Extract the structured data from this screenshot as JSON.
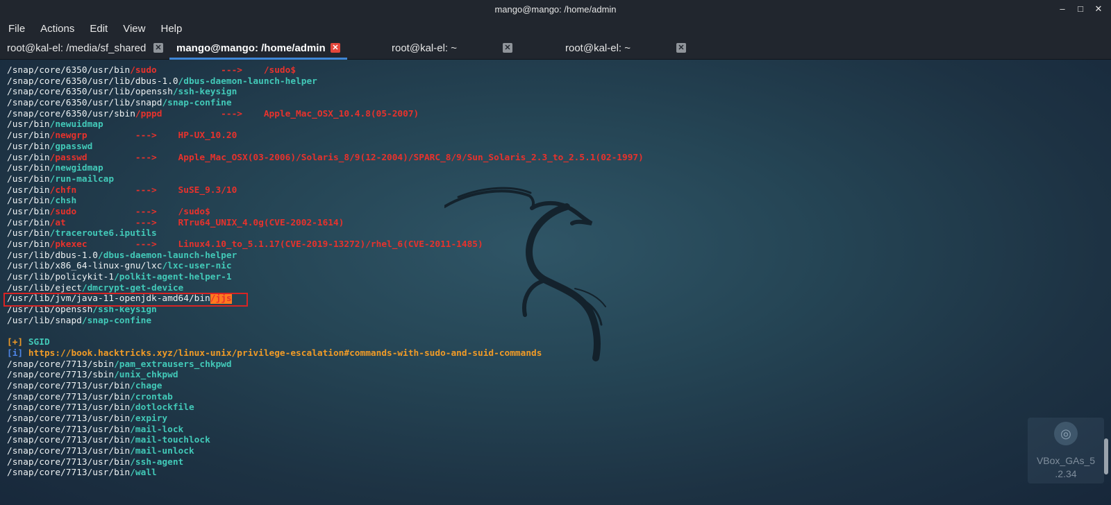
{
  "window": {
    "title": "mango@mango: /home/admin",
    "minimize_glyph": "–",
    "maximize_glyph": "□",
    "close_glyph": "✕"
  },
  "menu": [
    "File",
    "Actions",
    "Edit",
    "View",
    "Help"
  ],
  "tabs": [
    {
      "label": "root@kal-el: /media/sf_shared",
      "active": false,
      "close_icon": "✕"
    },
    {
      "label": "mango@mango: /home/admin",
      "active": true,
      "close_icon": "✕"
    },
    {
      "label": "root@kal-el: ~",
      "active": false,
      "close_icon": "✕"
    },
    {
      "label": "root@kal-el: ~",
      "active": false,
      "close_icon": "✕"
    }
  ],
  "colors": {
    "teal": "#42c9b8",
    "red": "#e8322c",
    "orange": "#f19b26",
    "blue": "#4f86e8",
    "highlight": "#ff7a1f",
    "active_tab_close": "#e4463b",
    "tab_underline": "#3f86d6"
  },
  "terminal": {
    "lines": [
      [
        {
          "t": "/snap/core/6350/usr/bin"
        },
        {
          "t": "/sudo",
          "c": "red"
        },
        {
          "t": "            --->    /sudo$",
          "c": "red"
        }
      ],
      [
        {
          "t": "/snap/core/6350/usr/lib/dbus-1.0"
        },
        {
          "t": "/dbus-daemon-launch-helper",
          "c": "teal"
        }
      ],
      [
        {
          "t": "/snap/core/6350/usr/lib/openssh"
        },
        {
          "t": "/ssh-keysign",
          "c": "teal"
        }
      ],
      [
        {
          "t": "/snap/core/6350/usr/lib/snapd"
        },
        {
          "t": "/snap-confine",
          "c": "teal"
        }
      ],
      [
        {
          "t": "/snap/core/6350/usr/sbin"
        },
        {
          "t": "/pppd",
          "c": "red"
        },
        {
          "t": "           --->    Apple_Mac_OSX_10.4.8(05-2007)",
          "c": "red"
        }
      ],
      [
        {
          "t": "/usr/bin"
        },
        {
          "t": "/newuidmap",
          "c": "teal"
        }
      ],
      [
        {
          "t": "/usr/bin"
        },
        {
          "t": "/newgrp",
          "c": "red"
        },
        {
          "t": "         --->    HP-UX_10.20",
          "c": "red"
        }
      ],
      [
        {
          "t": "/usr/bin"
        },
        {
          "t": "/gpasswd",
          "c": "teal"
        }
      ],
      [
        {
          "t": "/usr/bin"
        },
        {
          "t": "/passwd",
          "c": "red"
        },
        {
          "t": "         --->    Apple_Mac_OSX(03-2006)/Solaris_8/9(12-2004)/SPARC_8/9/Sun_Solaris_2.3_to_2.5.1(02-1997)",
          "c": "red"
        }
      ],
      [
        {
          "t": "/usr/bin"
        },
        {
          "t": "/newgidmap",
          "c": "teal"
        }
      ],
      [
        {
          "t": "/usr/bin"
        },
        {
          "t": "/run-mailcap",
          "c": "teal"
        }
      ],
      [
        {
          "t": "/usr/bin"
        },
        {
          "t": "/chfn",
          "c": "red"
        },
        {
          "t": "           --->    SuSE_9.3/10",
          "c": "red"
        }
      ],
      [
        {
          "t": "/usr/bin"
        },
        {
          "t": "/chsh",
          "c": "teal"
        }
      ],
      [
        {
          "t": "/usr/bin"
        },
        {
          "t": "/sudo",
          "c": "red"
        },
        {
          "t": "           --->    /sudo$",
          "c": "red"
        }
      ],
      [
        {
          "t": "/usr/bin"
        },
        {
          "t": "/at",
          "c": "red"
        },
        {
          "t": "             --->    RTru64_UNIX_4.0g(CVE-2002-1614)",
          "c": "red"
        }
      ],
      [
        {
          "t": "/usr/bin"
        },
        {
          "t": "/traceroute6.iputils",
          "c": "teal"
        }
      ],
      [
        {
          "t": "/usr/bin"
        },
        {
          "t": "/pkexec",
          "c": "red"
        },
        {
          "t": "         --->    Linux4.10_to_5.1.17(CVE-2019-13272)/rhel_6(CVE-2011-1485)",
          "c": "red"
        }
      ],
      [
        {
          "t": "/usr/lib/dbus-1.0"
        },
        {
          "t": "/dbus-daemon-launch-helper",
          "c": "teal"
        }
      ],
      [
        {
          "t": "/usr/lib/x86_64-linux-gnu/lxc"
        },
        {
          "t": "/lxc-user-nic",
          "c": "teal"
        }
      ],
      [
        {
          "t": "/usr/lib/policykit-1"
        },
        {
          "t": "/polkit-agent-helper-1",
          "c": "teal"
        }
      ],
      [
        {
          "t": "/usr/lib/eject"
        },
        {
          "t": "/dmcrypt-get-device",
          "c": "teal"
        }
      ],
      [
        {
          "t": "/usr/lib/jvm/java-11-openjdk-amd64/bin"
        },
        {
          "t": "/jjs",
          "c": "hl"
        }
      ],
      [
        {
          "t": "/usr/lib/openssh"
        },
        {
          "t": "/ssh-keysign",
          "c": "teal"
        }
      ],
      [
        {
          "t": "/usr/lib/snapd"
        },
        {
          "t": "/snap-confine",
          "c": "teal"
        }
      ],
      [],
      [
        {
          "t": "[+] ",
          "c": "orange"
        },
        {
          "t": "SGID",
          "c": "teal"
        }
      ],
      [
        {
          "t": "[i] ",
          "c": "blue"
        },
        {
          "t": "https://book.hacktricks.xyz/linux-unix/privilege-escalation#commands-with-sudo-and-suid-commands",
          "c": "orange"
        }
      ],
      [
        {
          "t": "/snap/core/7713/sbin"
        },
        {
          "t": "/pam_extrausers_chkpwd",
          "c": "teal"
        }
      ],
      [
        {
          "t": "/snap/core/7713/sbin"
        },
        {
          "t": "/unix_chkpwd",
          "c": "teal"
        }
      ],
      [
        {
          "t": "/snap/core/7713/usr/bin"
        },
        {
          "t": "/chage",
          "c": "teal"
        }
      ],
      [
        {
          "t": "/snap/core/7713/usr/bin"
        },
        {
          "t": "/crontab",
          "c": "teal"
        }
      ],
      [
        {
          "t": "/snap/core/7713/usr/bin"
        },
        {
          "t": "/dotlockfile",
          "c": "teal"
        }
      ],
      [
        {
          "t": "/snap/core/7713/usr/bin"
        },
        {
          "t": "/expiry",
          "c": "teal"
        }
      ],
      [
        {
          "t": "/snap/core/7713/usr/bin"
        },
        {
          "t": "/mail-lock",
          "c": "teal"
        }
      ],
      [
        {
          "t": "/snap/core/7713/usr/bin"
        },
        {
          "t": "/mail-touchlock",
          "c": "teal"
        }
      ],
      [
        {
          "t": "/snap/core/7713/usr/bin"
        },
        {
          "t": "/mail-unlock",
          "c": "teal"
        }
      ],
      [
        {
          "t": "/snap/core/7713/usr/bin"
        },
        {
          "t": "/ssh-agent",
          "c": "teal"
        }
      ],
      [
        {
          "t": "/snap/core/7713/usr/bin"
        },
        {
          "t": "/wall",
          "c": "teal"
        }
      ]
    ]
  },
  "desktop_icon": {
    "icon": "disc-icon",
    "glyph": "◎",
    "label_line1": "VBox_GAs_5",
    "label_line2": ".2.34"
  }
}
